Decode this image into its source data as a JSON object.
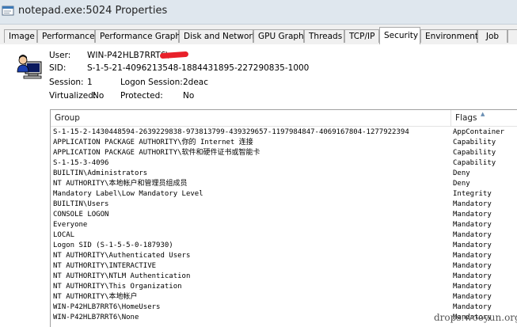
{
  "window": {
    "title": "notepad.exe:5024 Properties",
    "icon": "process-icon"
  },
  "tabs": [
    {
      "label": "Image",
      "active": false
    },
    {
      "label": "Performance",
      "active": false
    },
    {
      "label": "Performance Graph",
      "active": false
    },
    {
      "label": "Disk and Network",
      "active": false
    },
    {
      "label": "GPU Graph",
      "active": false
    },
    {
      "label": "Threads",
      "active": false
    },
    {
      "label": "TCP/IP",
      "active": false
    },
    {
      "label": "Security",
      "active": true
    },
    {
      "label": "Environment",
      "active": false
    },
    {
      "label": "Job",
      "active": false
    }
  ],
  "security": {
    "user_label": "User:",
    "user_value": "WIN-P42HLB7RRT6\\",
    "sid_label": "SID:",
    "sid_value": "S-1-5-21-4096213548-1884431895-227290835-1000",
    "session_label": "Session:",
    "session_value": "1",
    "logon_label": "Logon Session:",
    "logon_value": "2deac",
    "virtualized_label": "Virtualized:",
    "virtualized_value": "No",
    "protected_label": "Protected:",
    "protected_value": "No",
    "user_icon": "user-computer-icon",
    "redaction_color": "#e8202a"
  },
  "groups_table": {
    "columns": [
      "Group",
      "Flags"
    ],
    "rows": [
      {
        "group": "S-1-15-2-1430448594-2639229838-973813799-439329657-1197984847-4069167804-1277922394",
        "flags": "AppContainer"
      },
      {
        "group": "APPLICATION PACKAGE AUTHORITY\\你的 Internet 连接",
        "flags": "Capability"
      },
      {
        "group": "APPLICATION PACKAGE AUTHORITY\\软件和硬件证书或智能卡",
        "flags": "Capability"
      },
      {
        "group": "S-1-15-3-4096",
        "flags": "Capability"
      },
      {
        "group": "BUILTIN\\Administrators",
        "flags": "Deny"
      },
      {
        "group": "NT AUTHORITY\\本地帐户和管理员组成员",
        "flags": "Deny"
      },
      {
        "group": "Mandatory Label\\Low Mandatory Level",
        "flags": "Integrity"
      },
      {
        "group": "BUILTIN\\Users",
        "flags": "Mandatory"
      },
      {
        "group": "CONSOLE LOGON",
        "flags": "Mandatory"
      },
      {
        "group": "Everyone",
        "flags": "Mandatory"
      },
      {
        "group": "LOCAL",
        "flags": "Mandatory"
      },
      {
        "group": "Logon SID (S-1-5-5-0-187930)",
        "flags": "Mandatory"
      },
      {
        "group": "NT AUTHORITY\\Authenticated Users",
        "flags": "Mandatory"
      },
      {
        "group": "NT AUTHORITY\\INTERACTIVE",
        "flags": "Mandatory"
      },
      {
        "group": "NT AUTHORITY\\NTLM Authentication",
        "flags": "Mandatory"
      },
      {
        "group": "NT AUTHORITY\\This Organization",
        "flags": "Mandatory"
      },
      {
        "group": "NT AUTHORITY\\本地帐户",
        "flags": "Mandatory"
      },
      {
        "group": "WIN-P42HLB7RRT6\\HomeUsers",
        "flags": "Mandatory"
      },
      {
        "group": "WIN-P42HLB7RRT6\\None",
        "flags": "Mandatory"
      }
    ]
  },
  "watermark": "drops.wooyun.org"
}
